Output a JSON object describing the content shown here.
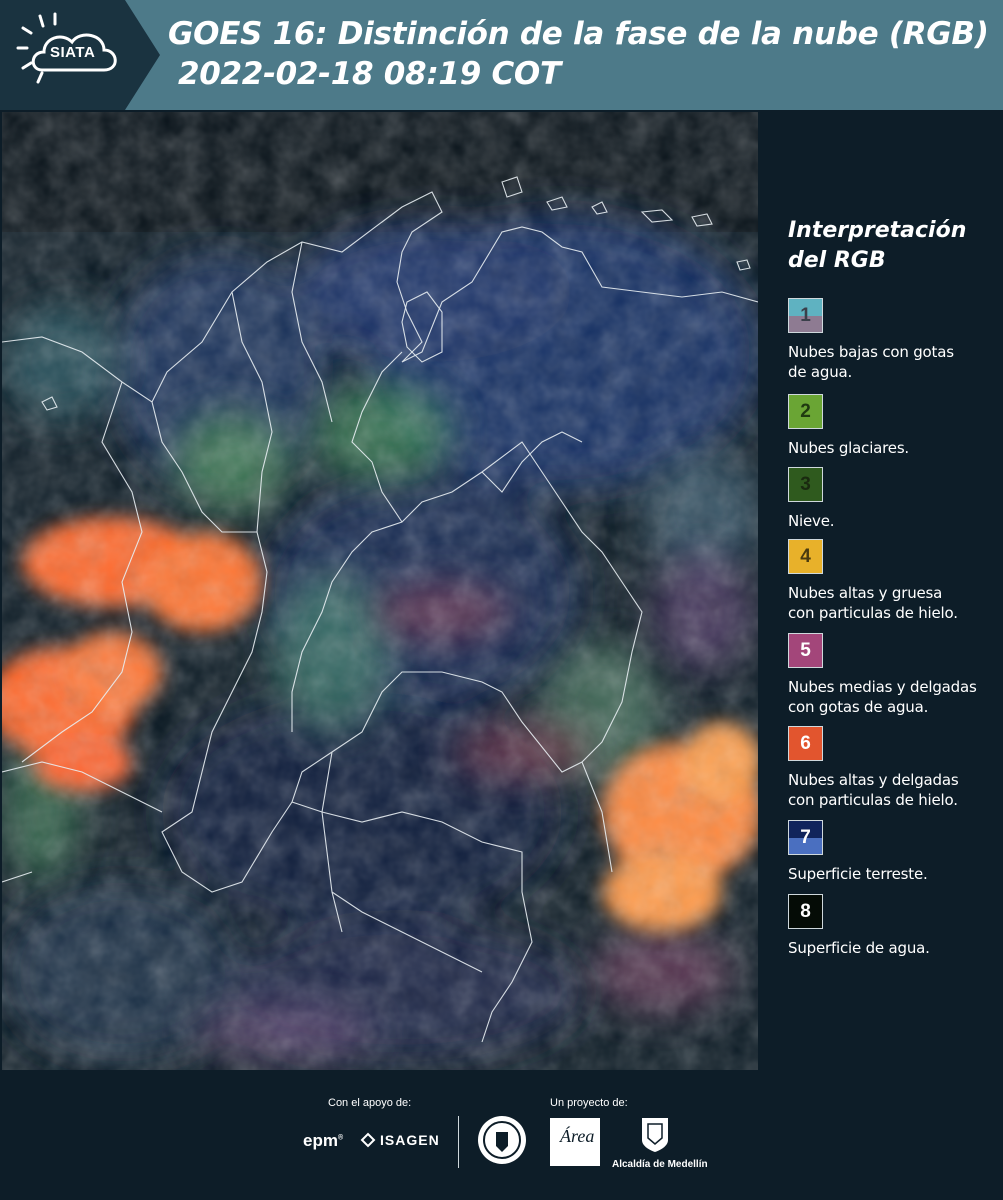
{
  "header": {
    "logo_text": "SIATA",
    "title_line1": "GOES 16: Distinción de la fase de la nube (RGB)",
    "title_line2": "2022-02-18 08:19 COT",
    "bg_color": "#4d7a89"
  },
  "legend": {
    "title_line1": "Interpretación",
    "title_line2": "del RGB",
    "items": [
      {
        "number": "1",
        "label_line1": "Nubes bajas con gotas",
        "label_line2": "de agua.",
        "color_top": "#5fb2c1",
        "color_bottom": "#8e7b92",
        "num_color": "#3a3f4a"
      },
      {
        "number": "2",
        "label_line1": "Nubes glaciares.",
        "label_line2": "",
        "color_top": "#6aa534",
        "color_bottom": "#6aa534",
        "num_color": "#1f3a10"
      },
      {
        "number": "3",
        "label_line1": "Nieve.",
        "label_line2": "",
        "color_top": "#2f5a1e",
        "color_bottom": "#2f5a1e",
        "num_color": "#1a2a10"
      },
      {
        "number": "4",
        "label_line1": "Nubes altas y gruesa",
        "label_line2": "con particulas de hielo.",
        "color_top": "#e8b12a",
        "color_bottom": "#e8b12a",
        "num_color": "#4a3a10"
      },
      {
        "number": "5",
        "label_line1": "Nubes medias y delgadas",
        "label_line2": "con gotas de agua.",
        "color_top": "#a3467a",
        "color_bottom": "#a3467a",
        "num_color": "#ffffff"
      },
      {
        "number": "6",
        "label_line1": "Nubes altas y delgadas",
        "label_line2": "con particulas de hielo.",
        "color_top": "#e2552e",
        "color_bottom": "#e2552e",
        "num_color": "#ffffff"
      },
      {
        "number": "7",
        "label_line1": "Superficie terreste.",
        "label_line2": "",
        "color_top": "#10245c",
        "color_bottom": "#4a6fc0",
        "num_color": "#ffffff"
      },
      {
        "number": "8",
        "label_line1": "Superficie de agua.",
        "label_line2": "",
        "color_top": "#050c06",
        "color_bottom": "#050c06",
        "num_color": "#ffffff"
      }
    ]
  },
  "footer": {
    "support_label": "Con el apoyo de:",
    "project_label": "Un proyecto de:",
    "sponsor1": "epm",
    "sponsor2": "ISAGEN",
    "area_logo_text": "Área",
    "medellin_label": "Alcaldía de Medellín"
  },
  "map": {
    "icon": "satellite-rgb-map"
  }
}
